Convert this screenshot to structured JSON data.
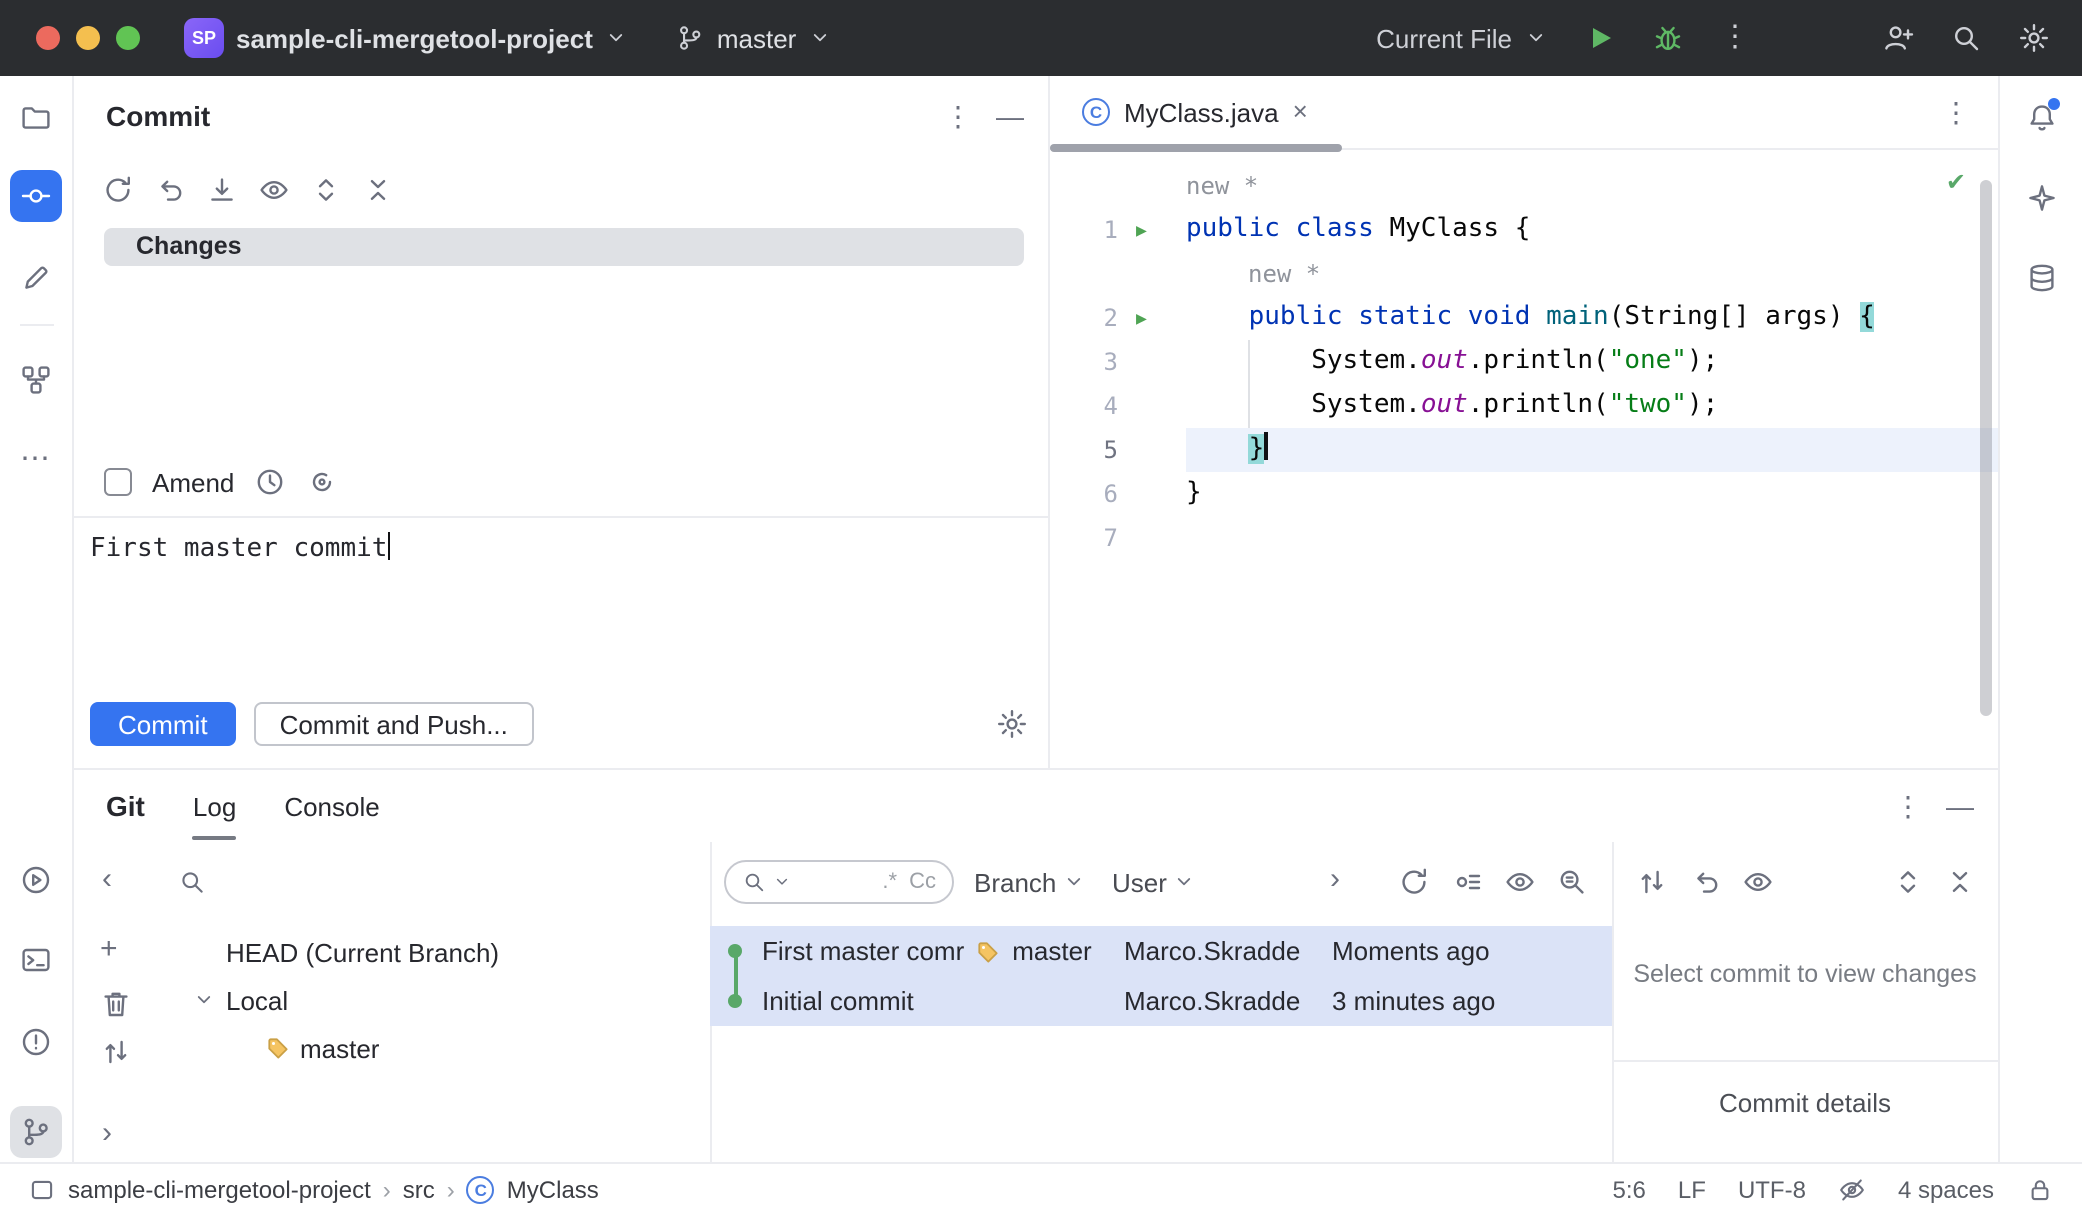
{
  "glyphs": {
    "kebab": "⋮",
    "minimize": "—",
    "close": "×",
    "plus": "+",
    "more": "⋯",
    "check": "✔",
    "run": "▶",
    "chevron_left": "‹",
    "chevron_right": "›",
    "class_letter": "C"
  },
  "titlebar": {
    "badge": "SP",
    "project": "sample-cli-mergetool-project",
    "branch": "master",
    "run_config": "Current File"
  },
  "commit_panel": {
    "title": "Commit",
    "changes_label": "Changes",
    "amend_label": "Amend",
    "message": "First master commit",
    "commit_button": "Commit",
    "commit_push_button": "Commit and Push..."
  },
  "editor": {
    "tab_label": "MyClass.java",
    "hint_above_class": "new *",
    "hint_above_method": "new *",
    "lines": [
      {
        "num": "1",
        "t0": "public class",
        "t1": " MyClass {"
      },
      {
        "num": "2",
        "t0": "    ",
        "t1": "public static void ",
        "t2": "main",
        "t3": "(String[] args) ",
        "t4": "{"
      },
      {
        "num": "3",
        "t0": "        System.",
        "t1": "out",
        "t2": ".println(",
        "t3": "\"one\"",
        "t4": ");"
      },
      {
        "num": "4",
        "t0": "        System.",
        "t1": "out",
        "t2": ".println(",
        "t3": "\"two\"",
        "t4": ");"
      },
      {
        "num": "5",
        "t0": "    ",
        "t1": "}"
      },
      {
        "num": "6",
        "t0": "}"
      },
      {
        "num": "7"
      }
    ]
  },
  "git_panel": {
    "title": "Git",
    "tab_log": "Log",
    "tab_console": "Console",
    "filter_regex": ".*",
    "filter_case": "Cc",
    "filter_branch": "Branch",
    "filter_user": "User",
    "tree": {
      "head": "HEAD (Current Branch)",
      "local": "Local",
      "branch": "master"
    },
    "commits": [
      {
        "message": "First master comr",
        "tag": "master",
        "author": "Marco.Skradde",
        "date": "Moments ago"
      },
      {
        "message": "Initial commit",
        "author": "Marco.Skradde",
        "date": "3 minutes ago"
      }
    ],
    "details_empty": "Select commit to view changes",
    "details_footer": "Commit details"
  },
  "statusbar": {
    "crumb_project": "sample-cli-mergetool-project",
    "crumb_src": "src",
    "crumb_class": "MyClass",
    "caret_position": "5:6",
    "line_separator": "LF",
    "encoding": "UTF-8",
    "indent": "4 spaces"
  },
  "colors": {
    "accent_blue": "#3574f0",
    "run_green": "#5fb865",
    "selection_blue": "#dbe3f7",
    "brace_match": "#93d9d9",
    "keyword": "#0033b3",
    "string": "#067d17",
    "field": "#871094",
    "method": "#00627a",
    "tag_yellow": "#f5c462",
    "titlebar_bg": "#2b2d30"
  }
}
